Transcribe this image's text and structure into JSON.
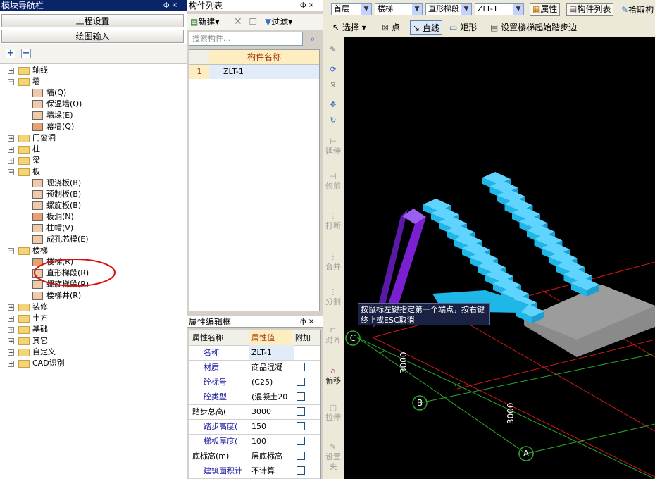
{
  "nav": {
    "title": "模块导航栏",
    "pin": "ф ×",
    "btn_project": "工程设置",
    "btn_draw": "绘图输入",
    "add": "+",
    "remove": "−",
    "tree": [
      {
        "label": "轴线",
        "level": 0,
        "exp": "+"
      },
      {
        "label": "墙",
        "level": 0,
        "exp": "−"
      },
      {
        "label": "墙(Q)",
        "level": 1
      },
      {
        "label": "保温墙(Q)",
        "level": 1
      },
      {
        "label": "墙垛(E)",
        "level": 1
      },
      {
        "label": "幕墙(Q)",
        "level": 1
      },
      {
        "label": "门窗洞",
        "level": 0,
        "exp": "+"
      },
      {
        "label": "柱",
        "level": 0,
        "exp": "+"
      },
      {
        "label": "梁",
        "level": 0,
        "exp": "+"
      },
      {
        "label": "板",
        "level": 0,
        "exp": "−"
      },
      {
        "label": "现浇板(B)",
        "level": 1
      },
      {
        "label": "预制板(B)",
        "level": 1
      },
      {
        "label": "螺旋板(B)",
        "level": 1
      },
      {
        "label": "板洞(N)",
        "level": 1
      },
      {
        "label": "柱帽(V)",
        "level": 1
      },
      {
        "label": "成孔芯模(E)",
        "level": 1
      },
      {
        "label": "楼梯",
        "level": 0,
        "exp": "−"
      },
      {
        "label": "楼梯(R)",
        "level": 1
      },
      {
        "label": "直形梯段(R)",
        "level": 1
      },
      {
        "label": "螺旋梯段(R)",
        "level": 1
      },
      {
        "label": "楼梯井(R)",
        "level": 1
      },
      {
        "label": "装修",
        "level": 0,
        "exp": "+"
      },
      {
        "label": "土方",
        "level": 0,
        "exp": "+"
      },
      {
        "label": "基础",
        "level": 0,
        "exp": "+"
      },
      {
        "label": "其它",
        "level": 0,
        "exp": "+"
      },
      {
        "label": "自定义",
        "level": 0,
        "exp": "+"
      },
      {
        "label": "CAD识别",
        "level": 0,
        "exp": "+"
      }
    ]
  },
  "components": {
    "title": "构件列表",
    "pin": "ф ×",
    "new_label": "新建",
    "filter_label": "过滤",
    "search_placeholder": "搜索构件...",
    "col_header": "构件名称",
    "rows": [
      {
        "num": "1",
        "name": "ZLT-1"
      }
    ]
  },
  "properties": {
    "title": "属性编辑框",
    "pin": "ф ×",
    "headers": [
      "属性名称",
      "属性值",
      "附加"
    ],
    "rows": [
      {
        "name": "名称",
        "value": "ZLT-1",
        "check": false,
        "blue": true
      },
      {
        "name": "材质",
        "value": "商品混凝",
        "check": true,
        "blue": true
      },
      {
        "name": "砼标号",
        "value": "(C25)",
        "check": true,
        "blue": true
      },
      {
        "name": "砼类型",
        "value": "(混凝土20",
        "check": true,
        "blue": true
      },
      {
        "name": "踏步总高(",
        "value": "3000",
        "check": true,
        "blue": false
      },
      {
        "name": "踏步高度(",
        "value": "150",
        "check": true,
        "blue": true
      },
      {
        "name": "梯板厚度(",
        "value": "100",
        "check": true,
        "blue": true
      },
      {
        "name": "底标高(m)",
        "value": "层底标高",
        "check": true,
        "blue": false
      },
      {
        "name": "建筑面积计",
        "value": "不计算",
        "check": true,
        "blue": true
      }
    ]
  },
  "toolbar": {
    "floor": "首层",
    "category": "楼梯",
    "type": "直形梯段",
    "element": "ZLT-1",
    "attr_label": "属性",
    "list_label": "构件列表",
    "pick_label": "拾取构"
  },
  "draw_toolbar": {
    "select_label": "选择",
    "point_label": "点",
    "line_label": "直线",
    "rect_label": "矩形",
    "set_step_label": "设置楼梯起始踏步边"
  },
  "vtools": [
    "延伸",
    "修剪",
    "打断",
    "合并",
    "分割",
    "对齐",
    "偏移",
    "拉伸",
    "设置夹"
  ],
  "canvas": {
    "tooltip": "按鼠标左键指定第一个端点，按右键终止或ESC取消",
    "dim1": "3000",
    "dim2": "3000",
    "axis_c": "C",
    "axis_b": "B",
    "axis_a": "A"
  },
  "colors": {
    "stair": "#1fb6e8",
    "column": "#7a1fd1",
    "slab": "#8a8a8a",
    "grid_red": "#d01818",
    "grid_green": "#2fa82f",
    "title_bar": "#0a246a"
  }
}
